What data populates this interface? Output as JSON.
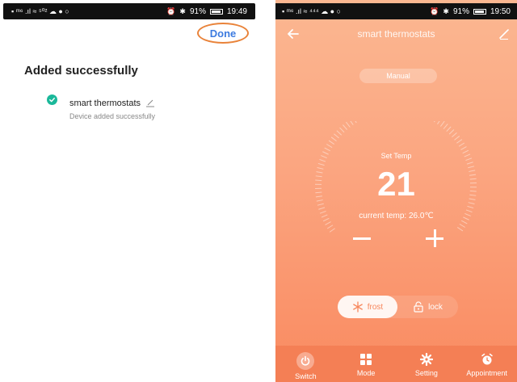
{
  "left_screen": {
    "status": {
      "left": "▪ ᵐ⁶ .ıl ≈ ⁵⁰² ☁ ● ○",
      "battery": "91%",
      "time": "19:49"
    },
    "done_label": "Done",
    "title": "Added successfully",
    "device": {
      "name": "smart thermostats",
      "subtitle": "Device added successfully"
    }
  },
  "right_screen": {
    "status": {
      "left": "▪ ᵐ⁶ .ıl ≈ ⁴⁴⁴ ☁ ● ○",
      "battery": "91%",
      "time": "19:50"
    },
    "header_title": "smart thermostats",
    "mode_pill": "Manual",
    "set_temp_label": "Set Temp",
    "set_temp_value": "21",
    "current_temp_label": "current temp:",
    "current_temp_value": "26.0℃",
    "frost_label": "frost",
    "lock_label": "lock",
    "tabs": [
      {
        "label": "Switch",
        "icon": "power-icon"
      },
      {
        "label": "Mode",
        "icon": "grid-icon"
      },
      {
        "label": "Setting",
        "icon": "gear-icon"
      },
      {
        "label": "Appointment",
        "icon": "alarm-clock-icon"
      }
    ],
    "colors": {
      "accent": "#f98a60",
      "bar": "#f47f55"
    }
  }
}
